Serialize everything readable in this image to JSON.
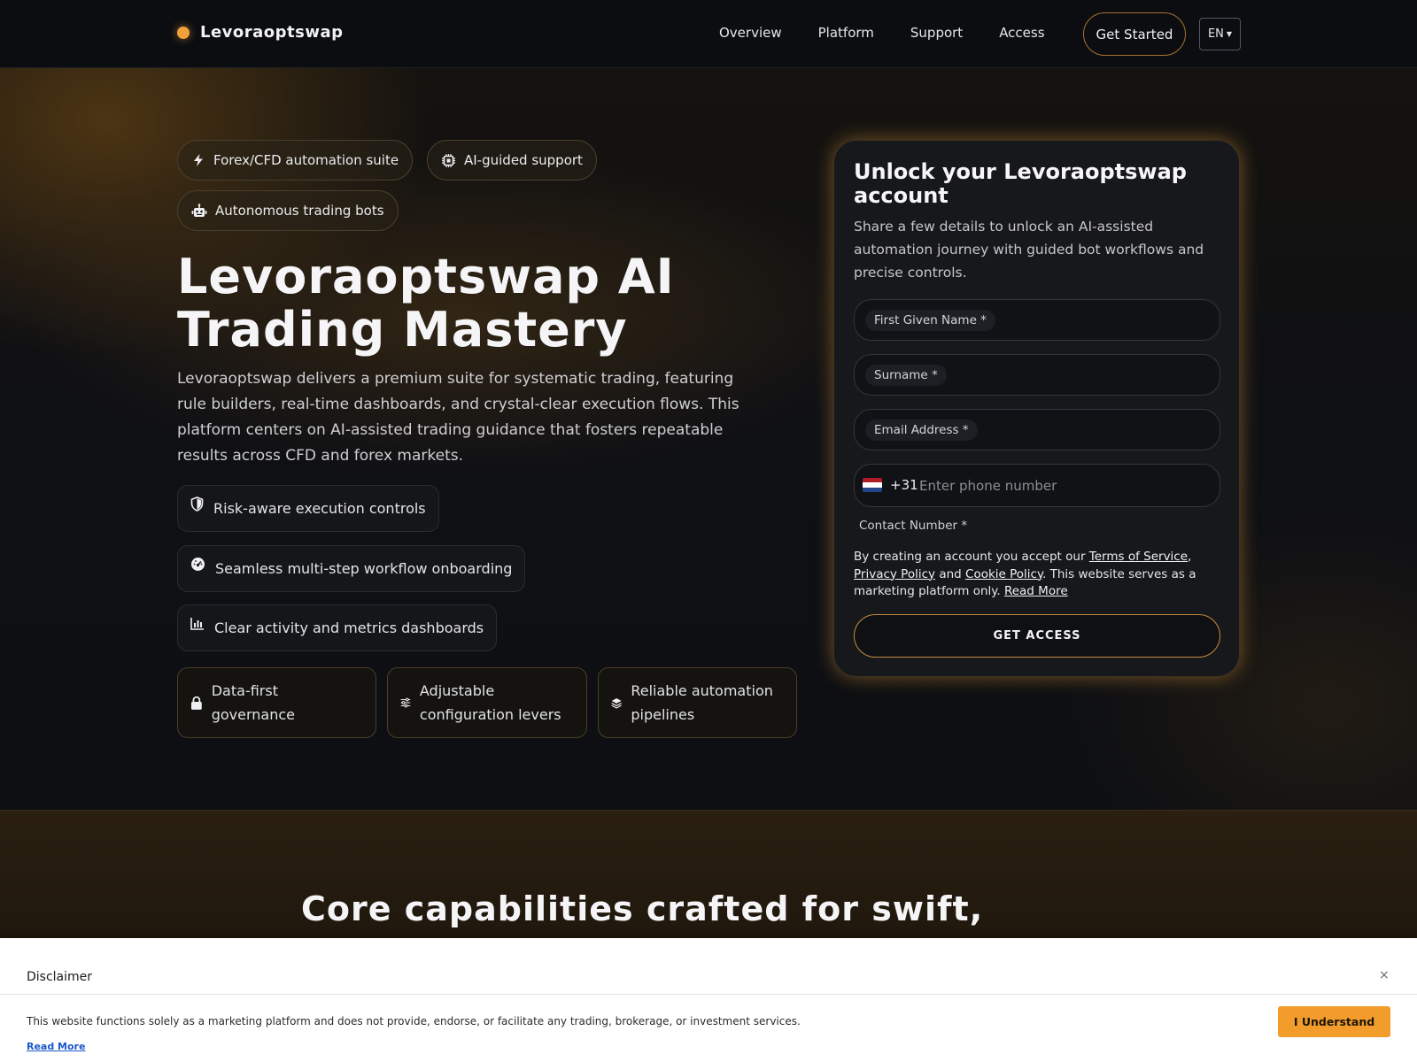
{
  "header": {
    "brand": "Levoraoptswap",
    "nav": [
      "Overview",
      "Platform",
      "Support",
      "Access"
    ],
    "cta": "Get Started",
    "language": "EN"
  },
  "hero": {
    "chips": [
      "Forex/CFD automation suite",
      "AI-guided support",
      "Autonomous trading bots"
    ],
    "title": "Levoraoptswap AI Trading Mastery",
    "description": "Levoraoptswap delivers a premium suite for systematic trading, featuring rule builders, real-time dashboards, and crystal-clear execution flows. This platform centers on AI-assisted trading guidance that fosters repeatable results across CFD and forex markets.",
    "features": [
      "Risk-aware execution controls",
      "Seamless multi-step workflow onboarding",
      "Clear activity and metrics dashboards"
    ],
    "cards": [
      "Data-first governance",
      "Adjustable configuration levers",
      "Reliable automation pipelines"
    ]
  },
  "form": {
    "title": "Unlock your Levoraoptswap account",
    "subtitle": "Share a few details to unlock an AI-assisted automation journey with guided bot workflows and precise controls.",
    "first_name_label": "First Given Name *",
    "surname_label": "Surname *",
    "email_label": "Email Address *",
    "dial_code": "+31",
    "phone_placeholder": "Enter phone number",
    "contact_label": "Contact Number *",
    "legal": {
      "prefix": "By creating an account you accept our",
      "terms": "Terms of Service",
      "comma": ",",
      "privacy": "Privacy Policy",
      "and": "and",
      "cookie": "Cookie Policy",
      "suffix": ". This website serves as a marketing platform only.",
      "read_more": "Read More"
    },
    "submit": "GET ACCESS"
  },
  "section2": {
    "title": "Core capabilities crafted for swift, disciplined execution"
  },
  "disclaimer": {
    "title": "Disclaimer",
    "close": "×",
    "text": "This website functions solely as a marketing platform and does not provide, endorse, or facilitate any trading, brokerage, or investment services.",
    "read_more": "Read More",
    "accept": "I Understand"
  },
  "colors": {
    "accent": "#f2a13a",
    "background": "#0d0f13",
    "accept_button": "#f29c2b"
  },
  "icons": [
    "bolt-icon",
    "chip-icon",
    "robot-icon",
    "shield-icon",
    "gauge-icon",
    "bar-chart-icon",
    "lock-icon",
    "sliders-icon",
    "layers-icon",
    "netherlands-flag-icon",
    "close-icon"
  ]
}
